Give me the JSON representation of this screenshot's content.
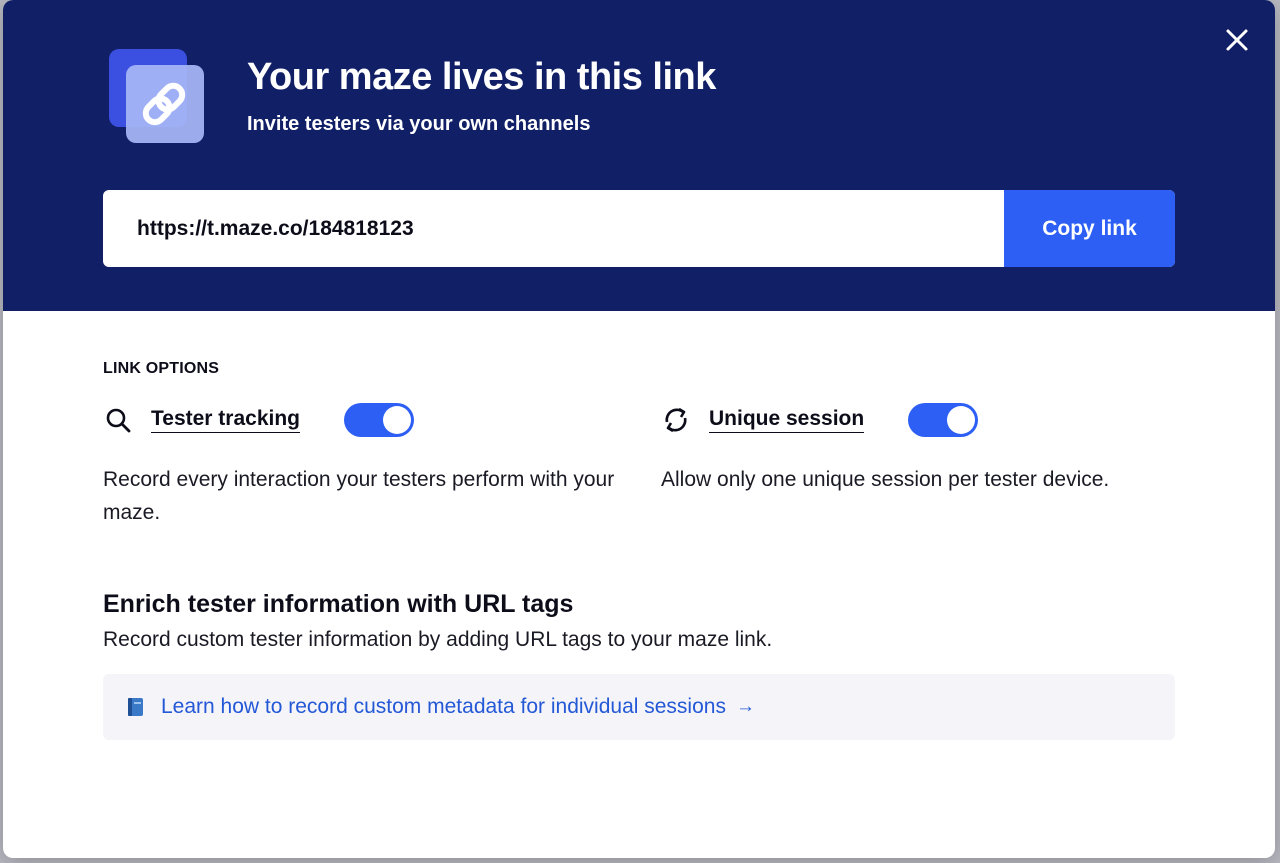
{
  "modal": {
    "title": "Your maze lives in this link",
    "subtitle": "Invite testers via your own channels",
    "link_url": "https://t.maze.co/184818123",
    "copy_label": "Copy link",
    "close_icon": "close-icon",
    "hero_icon": "link-chain-icon"
  },
  "link_options": {
    "label": "LINK OPTIONS",
    "options": [
      {
        "icon": "search-icon",
        "label": "Tester tracking",
        "enabled": true,
        "description": "Record every interaction your testers perform with your maze."
      },
      {
        "icon": "refresh-icon",
        "label": "Unique session",
        "enabled": true,
        "description": "Allow only one unique session per tester device."
      }
    ]
  },
  "enrich": {
    "title": "Enrich tester information with URL tags",
    "description": "Record custom tester information by adding URL tags to your maze link.",
    "learn_link": "Learn how to record custom metadata for individual sessions",
    "learn_icon": "book-icon",
    "arrow": "→"
  },
  "colors": {
    "header_bg": "#111f66",
    "accent": "#2d5ff5",
    "link_text": "#2458d6",
    "learn_box_bg": "#f4f4f9"
  }
}
